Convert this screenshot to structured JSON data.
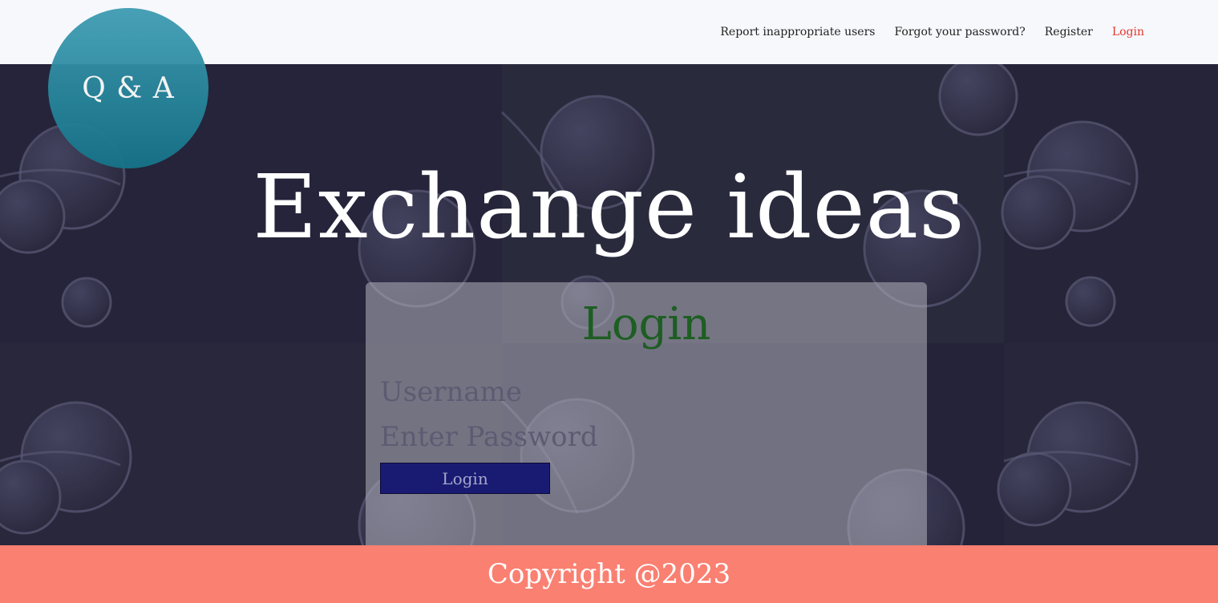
{
  "logo": {
    "text": "Q & A"
  },
  "nav": {
    "items": [
      {
        "label": "Report inappropriate users",
        "active": false
      },
      {
        "label": "Forgot your password?",
        "active": false
      },
      {
        "label": "Register",
        "active": false
      },
      {
        "label": "Login",
        "active": true
      }
    ]
  },
  "hero": {
    "headline": "Exchange ideas"
  },
  "login_form": {
    "title": "Login",
    "username_placeholder": "Username",
    "password_placeholder": "Enter Password",
    "submit_label": "Login"
  },
  "footer": {
    "text": "Copyright @2023"
  },
  "colors": {
    "nav_active": "#e5352d",
    "form_title": "#1d5e22",
    "button_bg": "#191b72",
    "footer_bg": "#fa8072",
    "logo_bg": "#1f7e95"
  }
}
